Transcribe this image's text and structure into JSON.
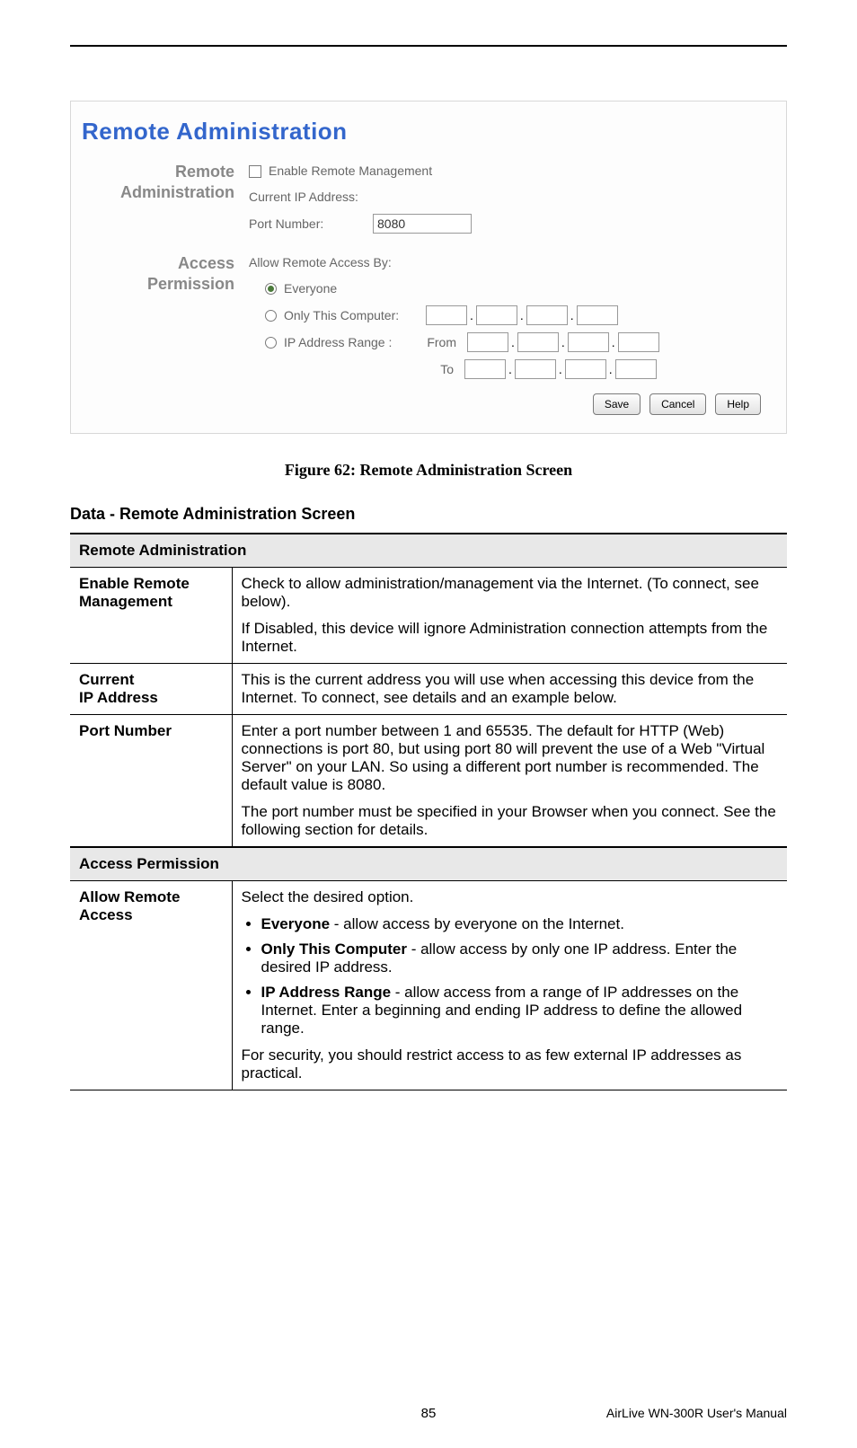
{
  "screenshot": {
    "title": "Remote Administration",
    "section1_label_line1": "Remote",
    "section1_label_line2": "Administration",
    "enable_label": "Enable Remote Management",
    "current_ip_label": "Current IP Address:",
    "port_label": "Port Number:",
    "port_value": "8080",
    "section2_label_line1": "Access",
    "section2_label_line2": "Permission",
    "allow_label": "Allow Remote Access By:",
    "opt_everyone": "Everyone",
    "opt_only": "Only This Computer:",
    "opt_range": "IP Address Range :",
    "from_label": "From",
    "to_label": "To",
    "btn_save": "Save",
    "btn_cancel": "Cancel",
    "btn_help": "Help"
  },
  "caption": "Figure 62: Remote Administration Screen",
  "data_heading": "Data - Remote Administration Screen",
  "table": {
    "section1": "Remote Administration",
    "row1_label": "Enable Remote Management",
    "row1_p1": "Check to allow administration/management via the Internet. (To connect, see below).",
    "row1_p2": "If Disabled, this device will ignore Administration connection attempts from the Internet.",
    "row2_label_line1": "Current",
    "row2_label_line2": "IP Address",
    "row2_p1": "This is the current address you will use when accessing this device from the Internet. To connect, see details and an example below.",
    "row3_label": "Port Number",
    "row3_p1": "Enter a port number between 1 and 65535. The default for HTTP (Web) connections is port 80, but using port 80 will prevent the use of a Web \"Virtual Server\" on your LAN. So using a different port number is recommended. The default value is 8080.",
    "row3_p2": "The port number must be specified in your Browser when you connect. See the following section for details.",
    "section2": "Access Permission",
    "row4_label_line1": "Allow Remote",
    "row4_label_line2": "Access",
    "row4_intro": "Select the desired option.",
    "row4_b1_strong": "Everyone",
    "row4_b1_rest": " - allow access by everyone on the Internet.",
    "row4_b2_strong": "Only This Computer",
    "row4_b2_rest": " - allow access by only one IP address. Enter the desired IP address.",
    "row4_b3_strong": "IP Address Range",
    "row4_b3_rest": " - allow access from a range of IP addresses on the Internet. Enter a beginning and ending IP address to define the allowed range.",
    "row4_outro": "For security, you should restrict access to as few external IP addresses as practical."
  },
  "footer": {
    "page": "85",
    "doc": "AirLive WN-300R User's Manual"
  }
}
